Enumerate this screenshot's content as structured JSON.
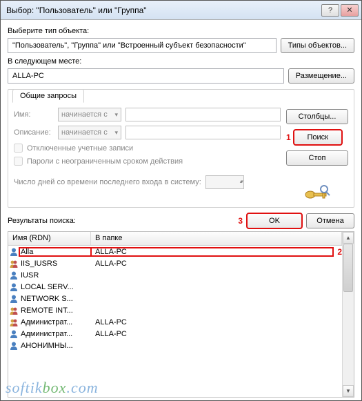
{
  "title": "Выбор: \"Пользователь\" или \"Группа\"",
  "labels": {
    "select_type": "Выберите тип объекта:",
    "type_value": "\"Пользователь\", \"Группа\" или \"Встроенный субъект безопасности\"",
    "types_btn": "Типы объектов...",
    "location_label": "В следующем месте:",
    "location_value": "ALLA-PC",
    "location_btn": "Размещение...",
    "tab": "Общие запросы",
    "name": "Имя:",
    "description": "Описание:",
    "starts_with": "начинается с",
    "disabled_accounts": "Отключенные учетные записи",
    "never_expire": "Пароли с неограниченным сроком действия",
    "days_since_login": "Число дней со времени последнего входа в систему:",
    "columns_btn": "Столбцы...",
    "search_btn": "Поиск",
    "stop_btn": "Стоп",
    "results_label": "Результаты поиска:",
    "ok_btn": "OK",
    "cancel_btn": "Отмена",
    "col_rdn": "Имя (RDN)",
    "col_folder": "В папке"
  },
  "annotations": {
    "n1": "1",
    "n2": "2",
    "n3": "3"
  },
  "results": [
    {
      "icon": "user",
      "rdn": "Alla",
      "folder": "ALLA-PC"
    },
    {
      "icon": "group",
      "rdn": "IIS_IUSRS",
      "folder": "ALLA-PC"
    },
    {
      "icon": "user",
      "rdn": "IUSR",
      "folder": ""
    },
    {
      "icon": "user",
      "rdn": "LOCAL SERV...",
      "folder": ""
    },
    {
      "icon": "user",
      "rdn": "NETWORK S...",
      "folder": ""
    },
    {
      "icon": "group",
      "rdn": "REMOTE INT...",
      "folder": ""
    },
    {
      "icon": "group",
      "rdn": "Администрат...",
      "folder": "ALLA-PC"
    },
    {
      "icon": "user",
      "rdn": "Администрат...",
      "folder": "ALLA-PC"
    },
    {
      "icon": "user",
      "rdn": "АНОНИМНЫ...",
      "folder": ""
    }
  ],
  "watermark": "softikbox.com"
}
